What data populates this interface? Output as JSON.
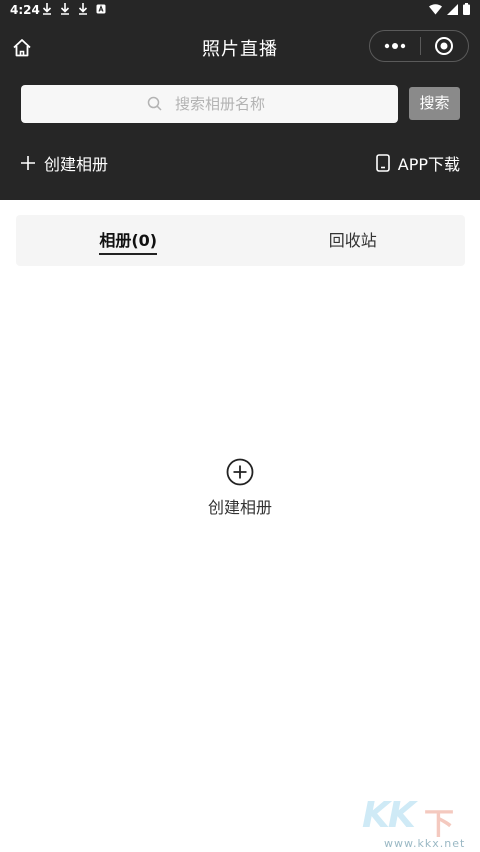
{
  "status_bar": {
    "time": "4:24"
  },
  "nav": {
    "title": "照片直播"
  },
  "search": {
    "placeholder": "搜索相册名称",
    "button_label": "搜索"
  },
  "actions": {
    "create_album_label": "创建相册",
    "app_download_label": "APP下载"
  },
  "tabs": [
    {
      "label": "相册(0)",
      "active": true
    },
    {
      "label": "回收站",
      "active": false
    }
  ],
  "empty_state": {
    "create_label": "创建相册"
  },
  "watermark": {
    "brand": "KK",
    "suffix": "下载",
    "url": "www.kkx.net"
  },
  "colors": {
    "header_background": "#262626",
    "search_button": "#8a8a8a",
    "tab_background": "#f5f5f5"
  }
}
